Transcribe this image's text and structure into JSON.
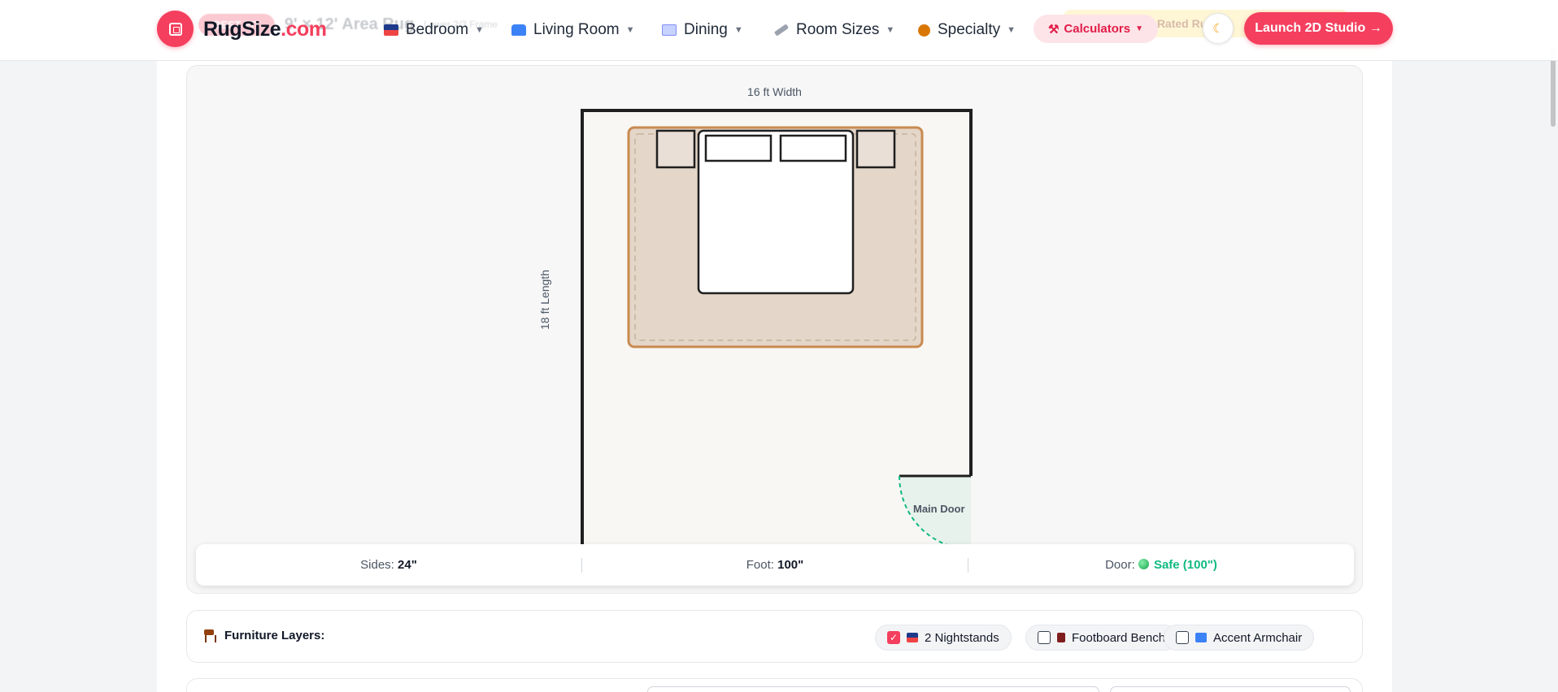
{
  "header": {
    "logo": {
      "name": "RugSize",
      "tld": ".com"
    },
    "background_banner": {
      "badge": "BEST FIT",
      "title": "9' × 12' Area Rug",
      "subtitle": "Lower 2/3 Frame",
      "cta": "View Top-Rated Rugs"
    },
    "nav": [
      {
        "label": "Bedroom",
        "icon": "bed-icon"
      },
      {
        "label": "Living Room",
        "icon": "sofa-icon"
      },
      {
        "label": "Dining",
        "icon": "dining-icon"
      },
      {
        "label": "Room Sizes",
        "icon": "ruler-icon"
      },
      {
        "label": "Specialty",
        "icon": "teddy-bear-icon"
      }
    ],
    "calculators_label": "Calculators",
    "launch_label": "Launch 2D Studio →",
    "theme_icon": "moon-icon"
  },
  "floor_plan": {
    "width_label": "16 ft Width",
    "length_label": "18 ft Length",
    "door_label": "Main Door",
    "room_ft": {
      "width": 16,
      "length": 18
    },
    "rug_ft": {
      "width": 9,
      "length": 12
    },
    "colors": {
      "wall": "#1f1f1f",
      "floor": "#f8f7f3",
      "rug_fill": "#e4d6c8",
      "rug_border": "#c98a4f",
      "door_fill": "#e8f2ec",
      "door_arc": "#10b981"
    }
  },
  "stats": {
    "sides_label": "Sides:",
    "sides_value": "24\"",
    "foot_label": "Foot:",
    "foot_value": "100\"",
    "door_label": "Door:",
    "door_value": "Safe (100\")",
    "door_status_color": "#10b981"
  },
  "layers": {
    "title": "Furniture Layers:",
    "items": [
      {
        "label": "2 Nightstands",
        "checked": true,
        "icon": "bed-icon"
      },
      {
        "label": "Footboard Bench",
        "checked": false,
        "icon": "chair-icon"
      },
      {
        "label": "Accent Armchair",
        "checked": false,
        "icon": "armchair-icon"
      }
    ]
  },
  "accent_color": "#f43f5e"
}
